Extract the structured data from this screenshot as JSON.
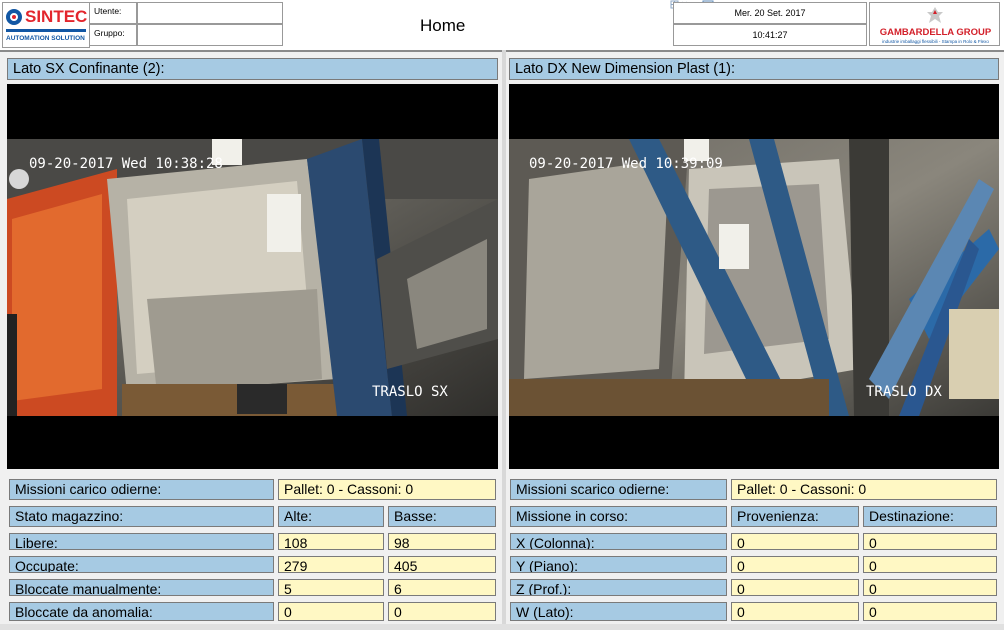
{
  "header": {
    "logo_left": {
      "name": "SINTEC",
      "tagline": "AUTOMATION SOLUTION"
    },
    "user_label": "Utente:",
    "user_value": "",
    "group_label": "Gruppo:",
    "group_value": "",
    "title": "Home",
    "date": "Mer. 20 Set. 2017",
    "time": "10:41:27",
    "logo_right": {
      "name": "GAMBARDELLA GROUP",
      "tagline": "industrie imballaggi flessibili - Stampa in Rolo & Flexo"
    }
  },
  "left_panel": {
    "title": "Lato SX Confinante (2):",
    "camera": {
      "timestamp": "09-20-2017 Wed 10:38:28",
      "label": "TRASLO SX"
    },
    "missions_label": "Missioni carico odierne:",
    "missions_value": "Pallet: 0 - Cassoni: 0",
    "status_label": "Stato magazzino:",
    "col_alte": "Alte:",
    "col_basse": "Basse:",
    "rows": [
      {
        "label": "Libere:",
        "alte": "108",
        "basse": "98"
      },
      {
        "label": "Occupate:",
        "alte": "279",
        "basse": "405"
      },
      {
        "label": "Bloccate manualmente:",
        "alte": "5",
        "basse": "6"
      },
      {
        "label": "Bloccate da anomalia:",
        "alte": "0",
        "basse": "0"
      }
    ]
  },
  "right_panel": {
    "title": "Lato DX New Dimension Plast (1):",
    "camera": {
      "timestamp": "09-20-2017 Wed 10:39:09",
      "label": "TRASLO DX"
    },
    "missions_label": "Missioni scarico odierne:",
    "missions_value": "Pallet: 0 - Cassoni: 0",
    "current_label": "Missione in corso:",
    "col_prov": "Provenienza:",
    "col_dest": "Destinazione:",
    "rows": [
      {
        "label": "X (Colonna):",
        "prov": "0",
        "dest": "0"
      },
      {
        "label": "Y (Piano):",
        "prov": "0",
        "dest": "0"
      },
      {
        "label": "Z (Prof.):",
        "prov": "0",
        "dest": "0"
      },
      {
        "label": "W (Lato):",
        "prov": "0",
        "dest": "0"
      }
    ]
  },
  "colors": {
    "label_bg": "#a6cae3",
    "value_bg": "#fff8c4",
    "sintec_red": "#e3262d",
    "sintec_blue": "#1257a4",
    "gambardella_red": "#d3202a"
  }
}
